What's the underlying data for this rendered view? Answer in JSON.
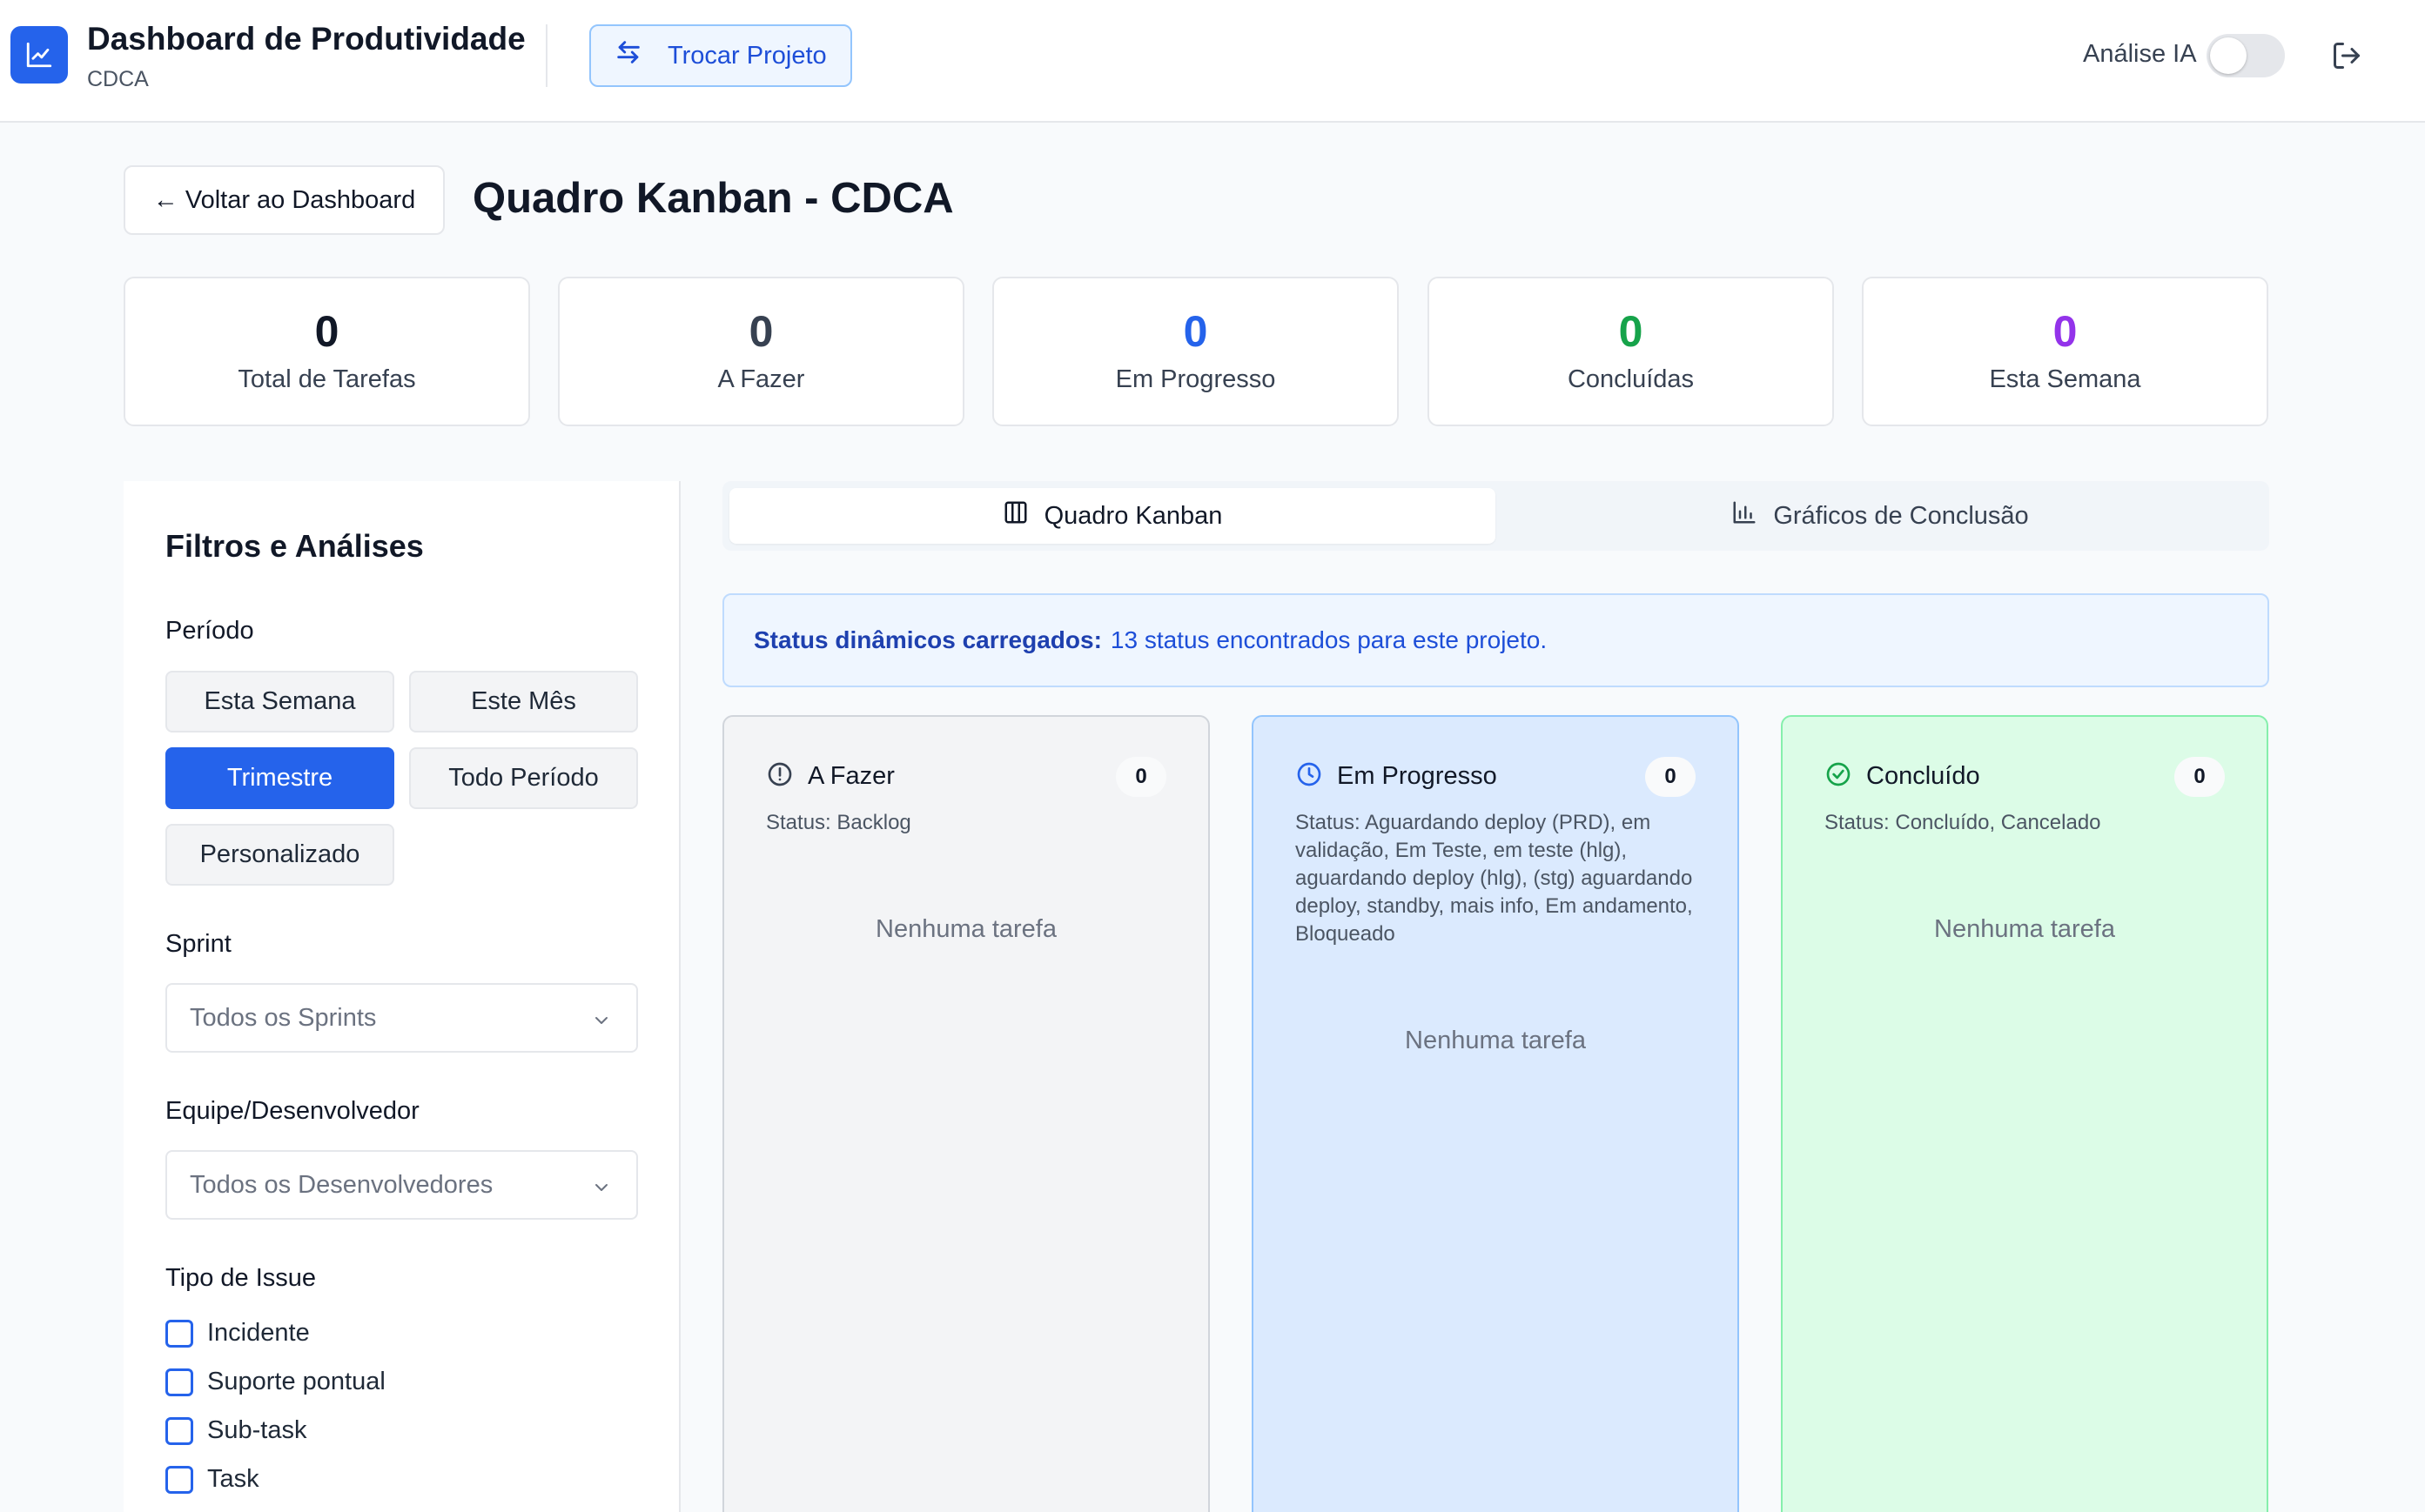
{
  "header": {
    "title": "Dashboard de Produtividade",
    "subtitle": "CDCA",
    "switch_project_label": "Trocar Projeto",
    "ai_label": "Análise IA",
    "ai_enabled": false
  },
  "page": {
    "back_label": "← Voltar ao Dashboard",
    "title": "Quadro Kanban - CDCA"
  },
  "stats": [
    {
      "value": "0",
      "label": "Total de Tarefas",
      "color": "#111827"
    },
    {
      "value": "0",
      "label": "A Fazer",
      "color": "#374151"
    },
    {
      "value": "0",
      "label": "Em Progresso",
      "color": "#2563eb"
    },
    {
      "value": "0",
      "label": "Concluídas",
      "color": "#16a34a"
    },
    {
      "value": "0",
      "label": "Esta Semana",
      "color": "#9333ea"
    }
  ],
  "filters": {
    "title": "Filtros e Análises",
    "period_label": "Período",
    "periods": [
      "Esta Semana",
      "Este Mês",
      "Trimestre",
      "Todo Período",
      "Personalizado"
    ],
    "active_period": "Trimestre",
    "sprint_label": "Sprint",
    "sprint_value": "Todos os Sprints",
    "team_label": "Equipe/Desenvolvedor",
    "team_value": "Todos os Desenvolvedores",
    "issue_type_label": "Tipo de Issue",
    "issue_types": [
      "Incidente",
      "Suporte pontual",
      "Sub-task",
      "Task"
    ]
  },
  "tabs": [
    {
      "label": "Quadro Kanban",
      "icon": "columns-icon",
      "active": true
    },
    {
      "label": "Gráficos de Conclusão",
      "icon": "bar-chart-icon",
      "active": false
    }
  ],
  "banner": {
    "bold": "Status dinâmicos carregados:",
    "text": "13 status encontrados para este projeto."
  },
  "columns": [
    {
      "title": "A Fazer",
      "icon": "alert-circle-icon",
      "count": "0",
      "status": "Status: Backlog",
      "empty": "Nenhuma tarefa"
    },
    {
      "title": "Em Progresso",
      "icon": "clock-icon",
      "count": "0",
      "status": "Status: Aguardando deploy (PRD), em validação, Em Teste, em teste (hlg), aguardando deploy (hlg), (stg) aguardando deploy, standby, mais info, Em andamento, Bloqueado",
      "empty": "Nenhuma tarefa"
    },
    {
      "title": "Concluído",
      "icon": "check-circle-icon",
      "count": "0",
      "status": "Status: Concluído, Cancelado",
      "empty": "Nenhuma tarefa"
    }
  ],
  "colors": {
    "accent": "#2563eb",
    "todo_bg": "#f3f4f6",
    "progress_bg": "#dbeafe",
    "done_bg": "#dcfce7"
  }
}
